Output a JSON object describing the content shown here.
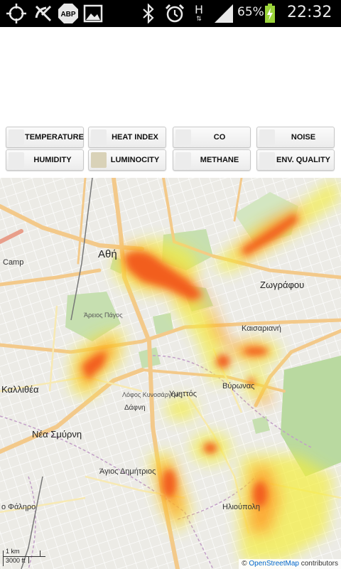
{
  "status_bar": {
    "battery_percent_text": "65%",
    "time": "22:32",
    "network_letter": "H",
    "icons": [
      "gps-icon",
      "no-signal-icon",
      "adblock-icon",
      "gallery-icon",
      "bluetooth-icon",
      "alarm-icon",
      "network-type-icon",
      "signal-icon",
      "battery-icon"
    ],
    "abp_text": "ABP"
  },
  "buttons": [
    {
      "label": "TEMPERATURE",
      "checked": false
    },
    {
      "label": "HEAT INDEX",
      "checked": false
    },
    {
      "label": "CO",
      "checked": false
    },
    {
      "label": "NOISE",
      "checked": false
    },
    {
      "label": "HUMIDITY",
      "checked": false
    },
    {
      "label": "LUMINOCITY",
      "checked": true
    },
    {
      "label": "METHANE",
      "checked": false
    },
    {
      "label": "ENV. QUALITY",
      "checked": false
    }
  ],
  "map": {
    "place_labels": {
      "athens": "Αθή",
      "kallithea": "Καλλιθέα",
      "nea_smyrni": "Νέα Σμύρνη",
      "zografou": "Ζωγράφου",
      "kaisariani": "Καισαριανή",
      "vyronas": "Βύρωνας",
      "ymittos": "Υμηττός",
      "dafni": "Δάφνη",
      "agios_dimitrios": "Άγιος Δημήτριος",
      "ilioupoli": "Ηλιούπολη",
      "faliro": "ο Φάληρο",
      "camp": "Camp",
      "areios_pagos": "Άρειος Πάγος",
      "lofos": "Λόφος Κυνοσάργους"
    },
    "scale_km": "1 km",
    "scale_ft": "3000 ft",
    "attribution_prefix": "© ",
    "attribution_link": "OpenStreetMap",
    "attribution_suffix": " contributors"
  },
  "colors": {
    "heat_core": "#f25a1f",
    "heat_mid": "#ff9a1e",
    "heat_edge": "#f4ee3a",
    "map_bg": "#ecebe6",
    "park": "#c6dfb0",
    "road_major": "#f5cf8e",
    "road_minor": "#ffffff"
  }
}
